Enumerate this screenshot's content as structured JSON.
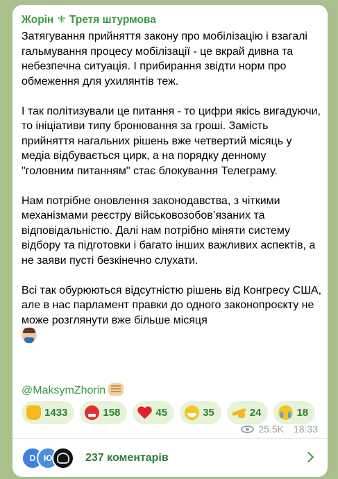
{
  "channel": {
    "title": "Жорін ⚜ Третя штурмова"
  },
  "post": {
    "paragraphs": [
      "Затягування прийняття закону про мобілізацію і взагалі гальмування процесу мобілізації - це вкрай дивна та небезпечна ситуація. І прибирання звідти норм про обмеження для ухилянтів теж.",
      "І так політизували це питання - то цифри якісь вигадуючи, то ініціативи типу бронювання за гроші. Замість прийняття нагальних рішень вже четвертий місяць у медіа відбувається цирк, а на порядку денному \"головним питанням\" стає блокування Телеграму.",
      "Нам потрібне оновлення законодавства, з чіткими механізмами реєстру військовозобов’язаних та відповідальністю. Далі нам потрібно міняти систему відбору та підготовки і багато інших важливих аспектів, а не заяви пусті безкінечно слухати.",
      "Всі так обурюються відсутністю рішень від Конгресу США, але в нас парламент правки до одного законопроєкту не може розглянути вже більше місяця"
    ],
    "trailing_emoji": "man-technologist-emoji",
    "author": "@MaksymZhorin",
    "author_emoji": "fist-bump-emoji"
  },
  "reactions": [
    {
      "icon": "thumbs-up-icon",
      "count": "1433"
    },
    {
      "icon": "angry-face-icon",
      "count": "158"
    },
    {
      "icon": "heart-icon",
      "count": "45"
    },
    {
      "icon": "grinning-face-icon",
      "count": "35"
    },
    {
      "icon": "pointing-hand-icon",
      "count": "24"
    },
    {
      "icon": "crying-face-icon",
      "count": "18"
    }
  ],
  "meta": {
    "views": "25.5K",
    "time": "18:33"
  },
  "comments": {
    "label": "237 коментарів",
    "avatars": [
      "D",
      "Ю",
      ""
    ]
  },
  "colors": {
    "background": "#a9c08e",
    "accent": "#3a9a3f",
    "reaction_bg": "#e6f3d9"
  }
}
